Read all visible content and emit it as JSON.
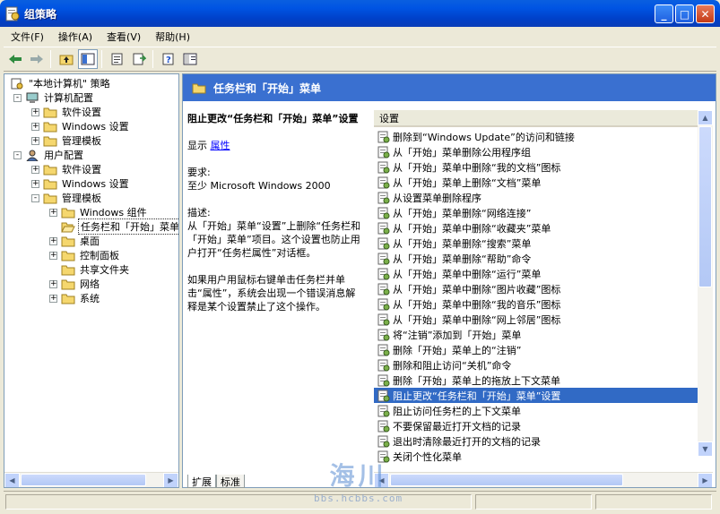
{
  "window": {
    "title": "组策略"
  },
  "menubar": [
    "文件(F)",
    "操作(A)",
    "查看(V)",
    "帮助(H)"
  ],
  "toolbar": [
    "back-icon",
    "forward-icon",
    "up-folder-icon",
    "show-tree-icon",
    "properties-icon",
    "export-icon",
    "help-icon",
    "extended-view-icon"
  ],
  "tree": [
    {
      "label": "\"本地计算机\" 策略",
      "level": 0,
      "expander": "",
      "icon": "policy-icon"
    },
    {
      "label": "计算机配置",
      "level": 1,
      "expander": "-",
      "icon": "computer-icon"
    },
    {
      "label": "软件设置",
      "level": 2,
      "expander": "+",
      "icon": "folder-icon"
    },
    {
      "label": "Windows 设置",
      "level": 2,
      "expander": "+",
      "icon": "folder-icon"
    },
    {
      "label": "管理模板",
      "level": 2,
      "expander": "+",
      "icon": "folder-icon"
    },
    {
      "label": "用户配置",
      "level": 1,
      "expander": "-",
      "icon": "user-icon"
    },
    {
      "label": "软件设置",
      "level": 2,
      "expander": "+",
      "icon": "folder-icon"
    },
    {
      "label": "Windows 设置",
      "level": 2,
      "expander": "+",
      "icon": "folder-icon"
    },
    {
      "label": "管理模板",
      "level": 2,
      "expander": "-",
      "icon": "folder-icon"
    },
    {
      "label": "Windows 组件",
      "level": 3,
      "expander": "+",
      "icon": "folder-icon"
    },
    {
      "label": "任务栏和「开始」菜单",
      "level": 3,
      "expander": "",
      "icon": "open-folder-icon",
      "selected": true
    },
    {
      "label": "桌面",
      "level": 3,
      "expander": "+",
      "icon": "folder-icon"
    },
    {
      "label": "控制面板",
      "level": 3,
      "expander": "+",
      "icon": "folder-icon"
    },
    {
      "label": "共享文件夹",
      "level": 3,
      "expander": "",
      "icon": "folder-icon"
    },
    {
      "label": "网络",
      "level": 3,
      "expander": "+",
      "icon": "folder-icon"
    },
    {
      "label": "系统",
      "level": 3,
      "expander": "+",
      "icon": "folder-icon"
    }
  ],
  "banner": {
    "title": "任务栏和「开始」菜单"
  },
  "description": {
    "title": "阻止更改“任务栏和「开始」菜单”设置",
    "show_label": "显示",
    "properties_link": "属性",
    "requirements_label": "要求:",
    "requirements_value": "至少 Microsoft Windows 2000",
    "desc_label": "描述:",
    "desc_text": "从「开始」菜单“设置”上删除“任务栏和「开始」菜单”项目。这个设置也防止用户打开“任务栏属性”对话框。",
    "desc_text2": "如果用户用鼠标右键单击任务栏并单击“属性”，系统会出现一个错误消息解释是某个设置禁止了这个操作。"
  },
  "list": {
    "header": "设置",
    "items": [
      "删除到“Windows Update”的访问和链接",
      "从「开始」菜单删除公用程序组",
      "从「开始」菜单中删除“我的文档”图标",
      "从「开始」菜单上删除“文档”菜单",
      "从设置菜单删除程序",
      "从「开始」菜单删除“网络连接”",
      "从「开始」菜单中删除“收藏夹”菜单",
      "从「开始」菜单删除“搜索”菜单",
      "从「开始」菜单删除“帮助”命令",
      "从「开始」菜单中删除“运行”菜单",
      "从「开始」菜单中删除“图片收藏”图标",
      "从「开始」菜单中删除“我的音乐”图标",
      "从「开始」菜单中删除“网上邻居”图标",
      "将“注销”添加到「开始」菜单",
      "删除「开始」菜单上的“注销”",
      "删除和阻止访问“关机”命令",
      "删除「开始」菜单上的拖放上下文菜单",
      "阻止更改“任务栏和「开始」菜单”设置",
      "阻止访问任务栏的上下文菜单",
      "不要保留最近打开文档的记录",
      "退出时清除最近打开的文档的记录",
      "关闭个性化菜单"
    ],
    "selected_index": 17
  },
  "tabs": [
    "扩展",
    "标准"
  ],
  "watermark": {
    "big": "海川",
    "small": "bbs.hcbbs.com"
  }
}
